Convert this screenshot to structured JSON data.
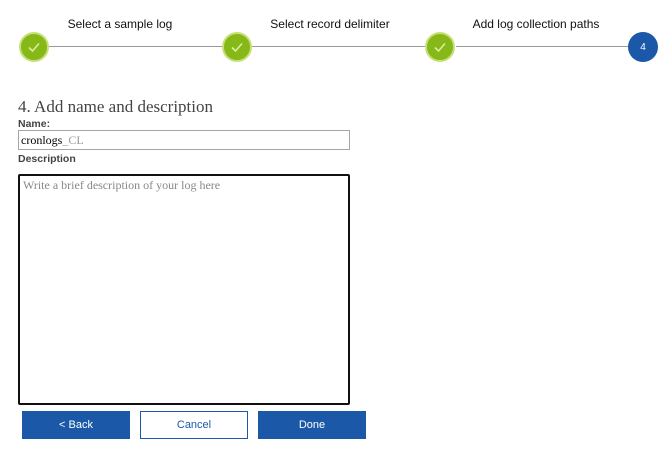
{
  "stepper": {
    "steps": [
      {
        "label": "Select a sample log",
        "state": "complete",
        "icon": "checkmark-icon"
      },
      {
        "label": "Select record delimiter",
        "state": "complete",
        "icon": "checkmark-icon"
      },
      {
        "label": "Add log collection paths",
        "state": "complete",
        "icon": "checkmark-icon"
      },
      {
        "label": "",
        "number": "4",
        "state": "active"
      }
    ],
    "colors": {
      "complete": "#86b817",
      "active": "#1b59a8",
      "line": "#9a9a9a"
    }
  },
  "form": {
    "title": "4. Add name and description",
    "name_label": "Name:",
    "name_value": "cronlogs",
    "name_suffix": "_CL",
    "description_label": "Description",
    "description_placeholder": "Write a brief description of your log here"
  },
  "buttons": {
    "back": "< Back",
    "cancel": "Cancel",
    "done": "Done"
  }
}
